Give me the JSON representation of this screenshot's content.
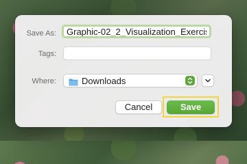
{
  "dialog": {
    "save_as_label": "Save As:",
    "save_as_value": "Graphic-02_2_Visualization_Exercis",
    "tags_label": "Tags:",
    "tags_value": "",
    "where_label": "Where:",
    "where_value": "Downloads",
    "where_icon": "folder-icon",
    "cancel_label": "Cancel",
    "save_label": "Save"
  },
  "colors": {
    "accent": "#5fa83c",
    "focus_ring": "#b8d9a0",
    "highlight_box": "#f2d53c",
    "folder": "#5ba7e0"
  }
}
